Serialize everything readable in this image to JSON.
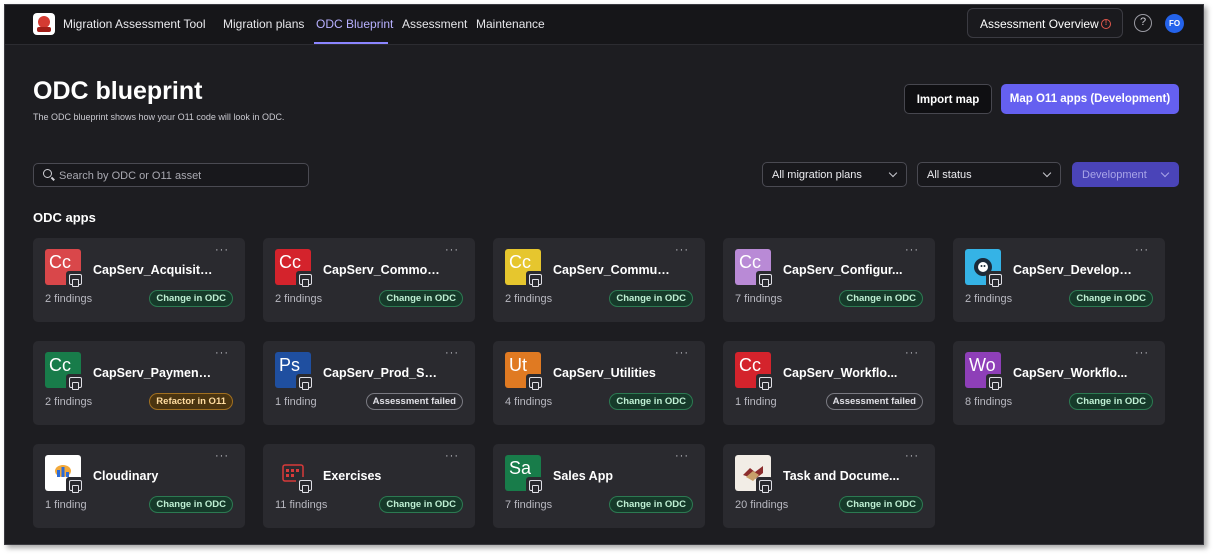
{
  "topbar": {
    "app_title": "Migration Assessment Tool",
    "nav": [
      "Migration plans",
      "ODC Blueprint",
      "Assessment",
      "Maintenance"
    ],
    "active_nav": "ODC Blueprint",
    "overview_button": "Assessment Overview",
    "warning_glyph": "!",
    "help_glyph": "?",
    "avatar_initials": "FO"
  },
  "header": {
    "title": "ODC blueprint",
    "subtitle": "The ODC blueprint shows how your O11 code will look in ODC.",
    "import_button": "Import map",
    "map_button": "Map O11 apps (Development)"
  },
  "filters": {
    "search_placeholder": "Search by ODC or O11 asset",
    "migration_plans": "All migration plans",
    "status": "All status",
    "environment": "Development"
  },
  "section_title": "ODC apps",
  "more_glyph": "···",
  "cards": [
    {
      "name": "CapServ_Acquisiti...",
      "icon_text": "Cc",
      "icon_color": "#d9474a",
      "findings": "2 findings",
      "badge": "Change in ODC",
      "badge_type": "green"
    },
    {
      "name": "CapServ_Common...",
      "icon_text": "Cc",
      "icon_color": "#d4232c",
      "findings": "2 findings",
      "badge": "Change in ODC",
      "badge_type": "green"
    },
    {
      "name": "CapServ_Commun...",
      "icon_text": "Cc",
      "icon_color": "#e6c62e",
      "findings": "2 findings",
      "badge": "Change in ODC",
      "badge_type": "green"
    },
    {
      "name": "CapServ_Configur...",
      "icon_text": "Cc",
      "icon_color": "#b98ad6",
      "findings": "7 findings",
      "badge": "Change in ODC",
      "badge_type": "green"
    },
    {
      "name": "CapServ_Develope...",
      "icon_text": "",
      "icon_color": "#35b3e6",
      "icon_kind": "gear-bug",
      "findings": "2 findings",
      "badge": "Change in ODC",
      "badge_type": "green"
    },
    {
      "name": "CapServ_Payment...",
      "icon_text": "Cc",
      "icon_color": "#187c4a",
      "findings": "2 findings",
      "badge": "Refactor in O11",
      "badge_type": "amber"
    },
    {
      "name": "CapServ_Prod_Sup...",
      "icon_text": "Ps",
      "icon_color": "#1f4fa0",
      "findings": "1 finding",
      "badge": "Assessment failed",
      "badge_type": "gray"
    },
    {
      "name": "CapServ_Utilities",
      "icon_text": "Ut",
      "icon_color": "#e07a22",
      "findings": "4 findings",
      "badge": "Change in ODC",
      "badge_type": "green"
    },
    {
      "name": "CapServ_Workflo...",
      "icon_text": "Cc",
      "icon_color": "#d4232c",
      "findings": "1 finding",
      "badge": "Assessment failed",
      "badge_type": "gray"
    },
    {
      "name": "CapServ_Workflo...",
      "icon_text": "Wo",
      "icon_color": "#8e3fb8",
      "findings": "8 findings",
      "badge": "Change in ODC",
      "badge_type": "green"
    },
    {
      "name": "Cloudinary",
      "icon_text": "",
      "icon_color": "#ffffff",
      "icon_kind": "cloud",
      "findings": "1 finding",
      "badge": "Change in ODC",
      "badge_type": "green"
    },
    {
      "name": "Exercises",
      "icon_text": "",
      "icon_color": "#2a2a2f",
      "icon_kind": "calendar",
      "findings": "11 findings",
      "badge": "Change in ODC",
      "badge_type": "green"
    },
    {
      "name": "Sales App",
      "icon_text": "Sa",
      "icon_color": "#187c4a",
      "findings": "7 findings",
      "badge": "Change in ODC",
      "badge_type": "green"
    },
    {
      "name": "Task and Docume...",
      "icon_text": "",
      "icon_color": "#f2ede6",
      "icon_kind": "handshake",
      "findings": "20 findings",
      "badge": "Change in ODC",
      "badge_type": "green"
    }
  ]
}
